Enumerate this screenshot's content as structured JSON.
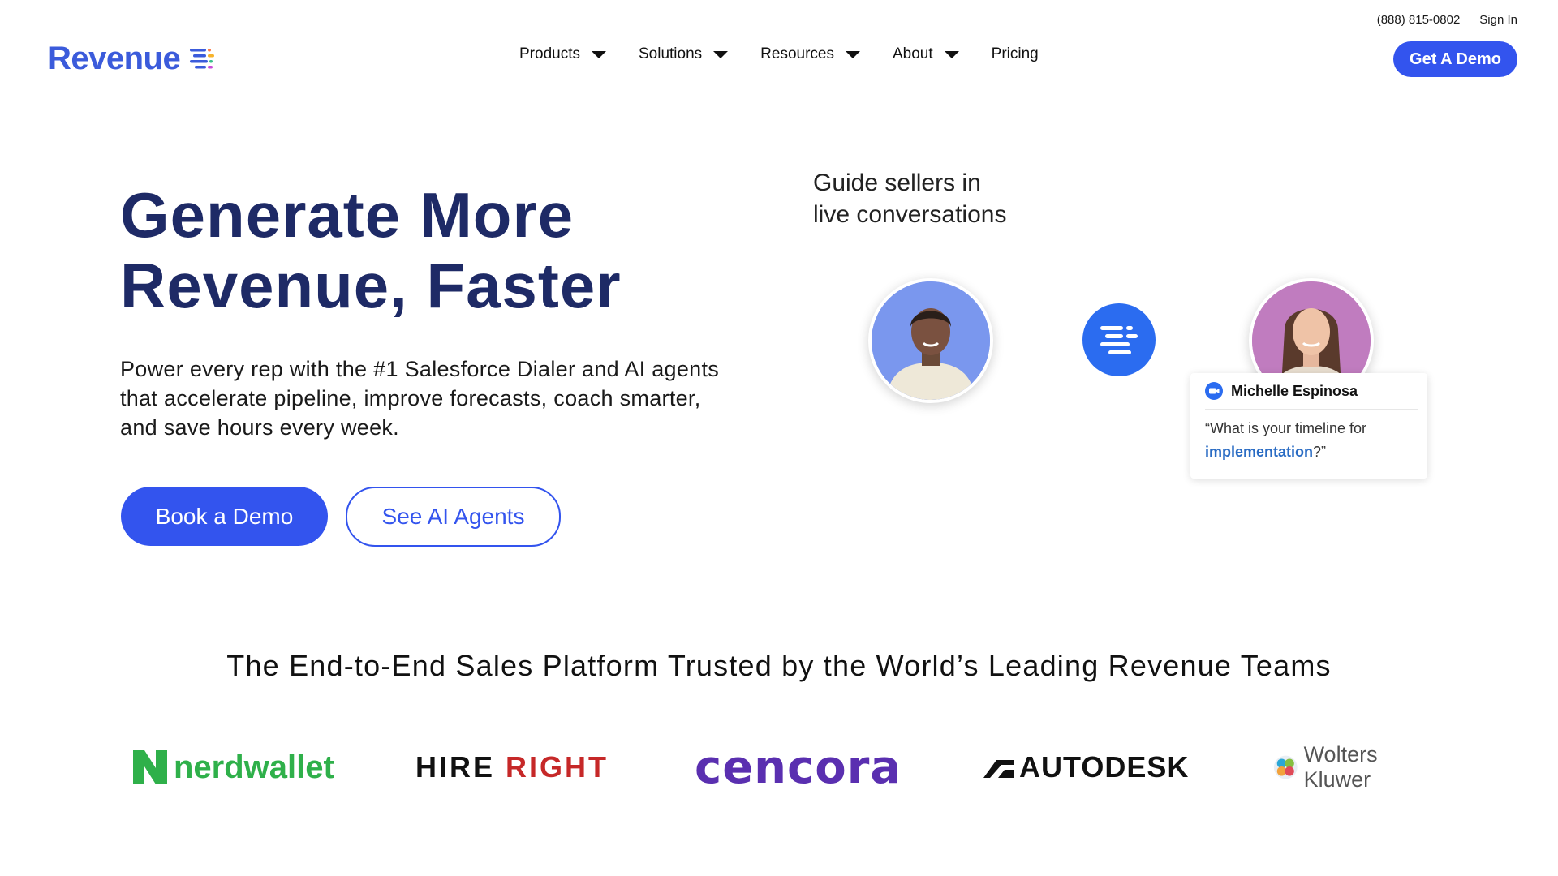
{
  "header": {
    "phone": "(888) 815-0802",
    "sign_in": "Sign In",
    "logo_text": "Revenue",
    "nav": [
      {
        "label": "Products",
        "has_dropdown": true
      },
      {
        "label": "Solutions",
        "has_dropdown": true
      },
      {
        "label": "Resources",
        "has_dropdown": true
      },
      {
        "label": "About",
        "has_dropdown": true
      },
      {
        "label": "Pricing",
        "has_dropdown": false
      }
    ],
    "cta": "Get A Demo"
  },
  "hero": {
    "headline_line1": "Generate More",
    "headline_line2": "Revenue, Faster",
    "subtext": "Power every rep with the #1 Salesforce Dialer and AI agents that accelerate pipeline, improve forecasts, coach smarter, and save hours every week.",
    "primary_button": "Book a Demo",
    "secondary_button": "See AI Agents"
  },
  "illustration": {
    "caption_line1": "Guide sellers in",
    "caption_line2": "live conversations",
    "card": {
      "name": "Michelle Espinosa",
      "quote_start": "“What is your timeline for",
      "quote_highlight": "implementation",
      "quote_end": "?”"
    }
  },
  "trusted": {
    "heading": "The End-to-End Sales Platform Trusted by the World’s Leading Revenue Teams",
    "logos": [
      {
        "name": "nerdwallet",
        "text": "nerdwallet"
      },
      {
        "name": "hireright",
        "text_a": "HIRE",
        "text_b": "RIGHT"
      },
      {
        "name": "cencora",
        "text": "cencora"
      },
      {
        "name": "autodesk",
        "text": "AUTODESK"
      },
      {
        "name": "wolters-kluwer",
        "text": "Wolters Kluwer"
      }
    ]
  },
  "colors": {
    "brand_blue": "#3354ee",
    "headline_navy": "#1e2a66",
    "highlight_blue": "#2a6cc4"
  },
  "icons": [
    "revenue-logo-icon",
    "chevron-down-icon",
    "revenue-bubble-icon",
    "video-call-icon",
    "nerdwallet-logo-icon",
    "autodesk-logo-icon",
    "wolters-kluwer-logo-icon"
  ]
}
